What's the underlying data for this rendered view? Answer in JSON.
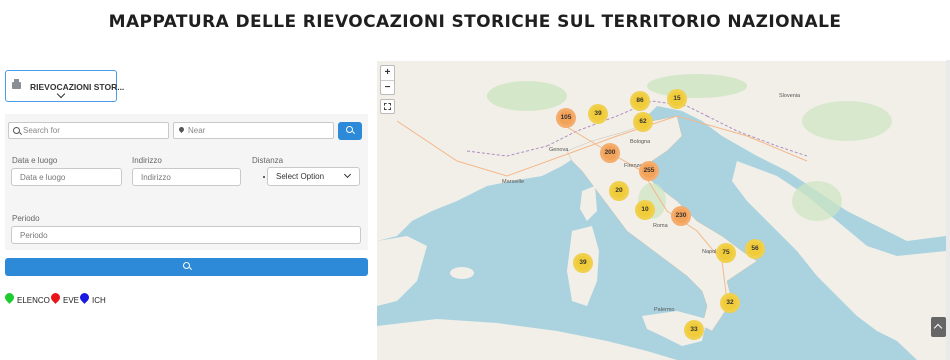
{
  "header": {
    "title": "MAPPATURA DELLE RIEVOCAZIONI STORICHE SUL TERRITORIO NAZIONALE"
  },
  "category_select": {
    "label": "RIEVOCAZIONI STOR...",
    "icon": "building-icon"
  },
  "search": {
    "keyword_placeholder": "Search for",
    "near_placeholder": "Near",
    "button_icon": "search-icon"
  },
  "filters": {
    "date_label": "Data e luogo",
    "date_placeholder": "Data e luogo",
    "address_label": "Indirizzo",
    "address_placeholder": "Indirizzo",
    "distance_label": "Distanza",
    "distance_value": "Select Option",
    "period_label": "Periodo",
    "period_placeholder": "Periodo"
  },
  "submit_button": {
    "icon": "search-icon"
  },
  "legend": [
    {
      "label": "ELENCO",
      "color": "#1fcc2f"
    },
    {
      "label": "EVE",
      "color": "#e8141a"
    },
    {
      "label": "ICH",
      "color": "#1919e0"
    }
  ],
  "map": {
    "zoom_in": "+",
    "zoom_out": "−",
    "clusters": [
      {
        "count": "105",
        "color": "orange"
      },
      {
        "count": "39",
        "color": "yellow"
      },
      {
        "count": "86",
        "color": "yellow"
      },
      {
        "count": "15",
        "color": "yellow"
      },
      {
        "count": "62",
        "color": "yellow"
      },
      {
        "count": "200",
        "color": "orange"
      },
      {
        "count": "255",
        "color": "orange"
      },
      {
        "count": "20",
        "color": "yellow"
      },
      {
        "count": "10",
        "color": "yellow"
      },
      {
        "count": "230",
        "color": "orange"
      },
      {
        "count": "39",
        "color": "yellow"
      },
      {
        "count": "75",
        "color": "yellow"
      },
      {
        "count": "56",
        "color": "yellow"
      },
      {
        "count": "32",
        "color": "yellow"
      },
      {
        "count": "33",
        "color": "yellow"
      }
    ],
    "labels": [
      "Slovenia",
      "Bologna",
      "Firenze",
      "Genova",
      "Marseille",
      "Roma",
      "Palermo",
      "Napoli"
    ]
  }
}
